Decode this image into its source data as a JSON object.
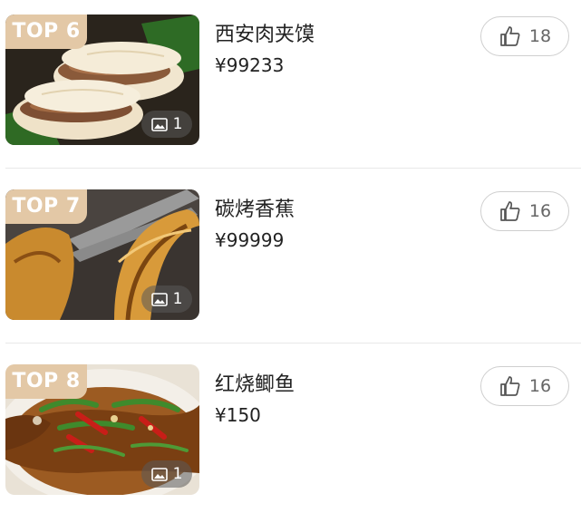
{
  "items": [
    {
      "rank": "TOP 6",
      "name": "西安肉夹馍",
      "price": "¥99233",
      "likes": "18",
      "photo_count": "1",
      "icon_like": "thumbs-up-icon",
      "icon_photo": "image-icon"
    },
    {
      "rank": "TOP 7",
      "name": "碳烤香蕉",
      "price": "¥99999",
      "likes": "16",
      "photo_count": "1",
      "icon_like": "thumbs-up-icon",
      "icon_photo": "image-icon"
    },
    {
      "rank": "TOP 8",
      "name": "红烧鲫鱼",
      "price": "¥150",
      "likes": "16",
      "photo_count": "1",
      "icon_like": "thumbs-up-icon",
      "icon_photo": "image-icon"
    }
  ],
  "colors": {
    "badge": "#e3c8a6",
    "text": "#222222",
    "like_text": "#666666",
    "border": "#cfcfcf",
    "divider": "#e8e8e8"
  }
}
